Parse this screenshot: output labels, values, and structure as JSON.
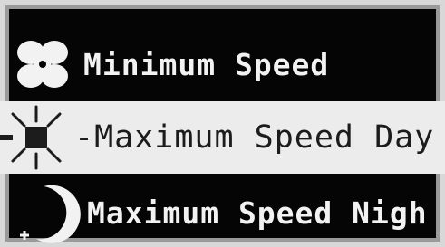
{
  "menu": {
    "items": [
      {
        "label": "Minimum Speed",
        "icon": "fan-icon",
        "selected": false
      },
      {
        "label": "-Maximum Speed Day",
        "icon": "sun-icon",
        "selected": true
      },
      {
        "label": "Maximum Speed Nigh",
        "icon": "moon-icon",
        "selected": false
      }
    ]
  },
  "colors": {
    "background": "#050505",
    "text": "#f2f2f2",
    "highlight_bg": "#ececec",
    "highlight_text": "#1c1c1c"
  }
}
